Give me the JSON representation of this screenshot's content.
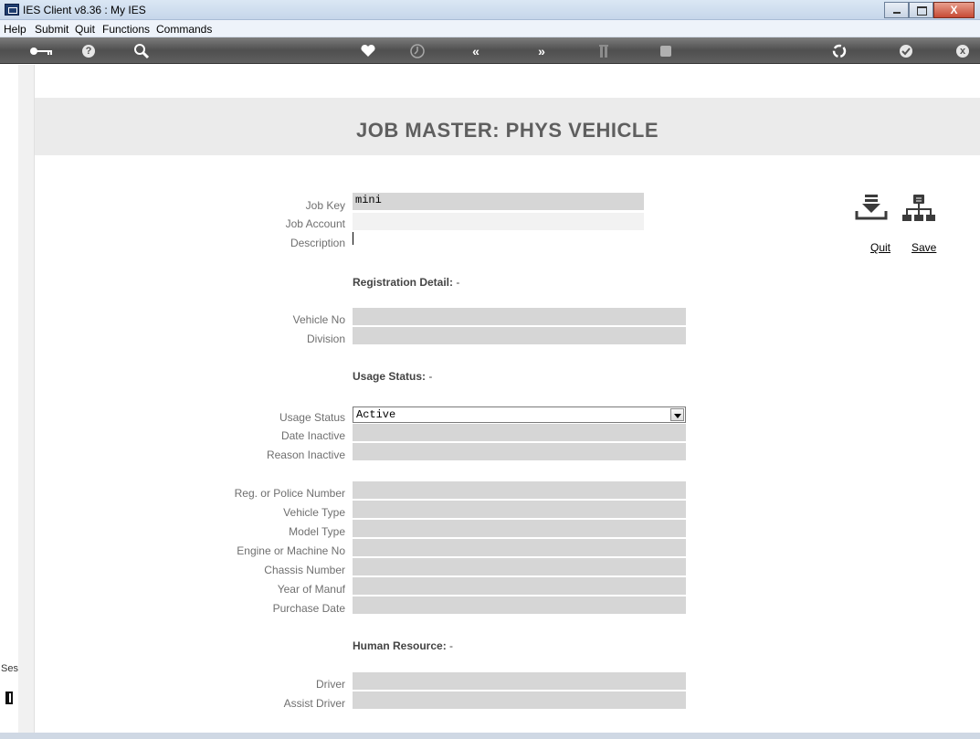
{
  "window": {
    "title": "IES Client v8.36 : My IES",
    "close_glyph": "X"
  },
  "menu": {
    "items": [
      "Help",
      "Submit",
      "Quit",
      "Functions",
      "Commands"
    ]
  },
  "toolbar": {
    "icons": [
      "key-icon",
      "help-icon",
      "search-icon",
      "heart-icon",
      "clock-icon",
      "previous-icon",
      "next-icon",
      "columns-icon",
      "stop-icon",
      "recycle-icon",
      "check-icon",
      "close-icon"
    ],
    "glyphs": {
      "help": "?",
      "prev": "«",
      "next": "»",
      "close": "x"
    }
  },
  "page": {
    "title": "JOB MASTER: PHYS VEHICLE"
  },
  "sidebar": {
    "ses_label": "Ses"
  },
  "actions": {
    "quit_label": "Quit",
    "save_label": "Save"
  },
  "form": {
    "job_key": {
      "label": "Job Key",
      "value": "mini"
    },
    "job_account": {
      "label": "Job Account",
      "value": ""
    },
    "description": {
      "label": "Description",
      "value": ""
    },
    "registration_section": {
      "title": "Registration Detail:",
      "suffix": " -"
    },
    "vehicle_no": {
      "label": "Vehicle No",
      "value": ""
    },
    "division": {
      "label": "Division",
      "value": ""
    },
    "usage_section": {
      "title": "Usage Status:",
      "suffix": " -"
    },
    "usage_status": {
      "label": "Usage Status",
      "value": "Active"
    },
    "date_inactive": {
      "label": "Date Inactive",
      "value": ""
    },
    "reason_inactive": {
      "label": "Reason Inactive",
      "value": ""
    },
    "reg_police_number": {
      "label": "Reg. or Police Number",
      "value": ""
    },
    "vehicle_type": {
      "label": "Vehicle Type",
      "value": ""
    },
    "model_type": {
      "label": "Model Type",
      "value": ""
    },
    "engine_machine_no": {
      "label": "Engine or Machine No",
      "value": ""
    },
    "chassis_number": {
      "label": "Chassis Number",
      "value": ""
    },
    "year_of_manuf": {
      "label": "Year of Manuf",
      "value": ""
    },
    "purchase_date": {
      "label": "Purchase Date",
      "value": ""
    },
    "hr_section": {
      "title": "Human Resource:",
      "suffix": " -"
    },
    "driver": {
      "label": "Driver",
      "value": ""
    },
    "assist_driver": {
      "label": "Assist Driver",
      "value": ""
    }
  }
}
